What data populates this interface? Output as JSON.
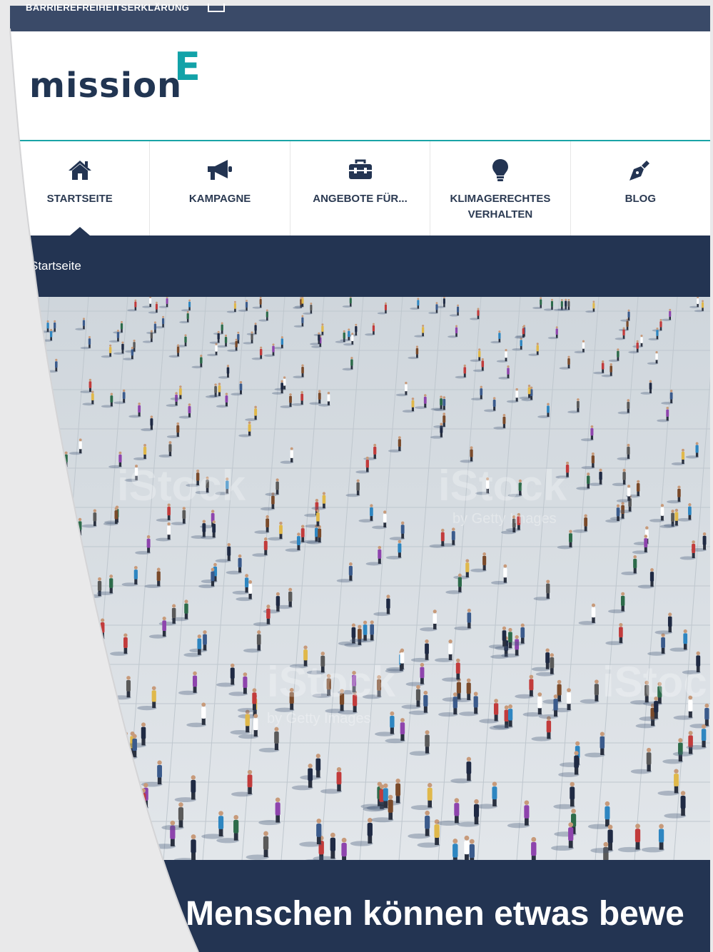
{
  "topbar": {
    "accessibility_link": "BARRIEREFREIHEITSERKLÄRUNG",
    "keyboard_icon": "keyboard-icon"
  },
  "logo": {
    "word": "mission",
    "superscript": "E"
  },
  "colors": {
    "navy": "#233452",
    "teal": "#12a2a8",
    "topbar": "#3a4a68"
  },
  "nav": {
    "items": [
      {
        "label": "STARTSEITE",
        "icon": "home-icon",
        "active": true
      },
      {
        "label": "KAMPAGNE",
        "icon": "megaphone-icon",
        "active": false
      },
      {
        "label": "ANGEBOTE FÜR...",
        "icon": "toolbox-icon",
        "active": false
      },
      {
        "label": "KLIMAGERECHTES\nVERHALTEN",
        "icon": "lightbulb-icon",
        "active": false
      },
      {
        "label": "BLOG",
        "icon": "pen-icon",
        "active": false
      }
    ]
  },
  "breadcrumb": {
    "current": "Startseite"
  },
  "hero": {
    "watermark": "iStock",
    "watermark_sub": "by Getty Images",
    "title": "Menschen können etwas bewe"
  }
}
